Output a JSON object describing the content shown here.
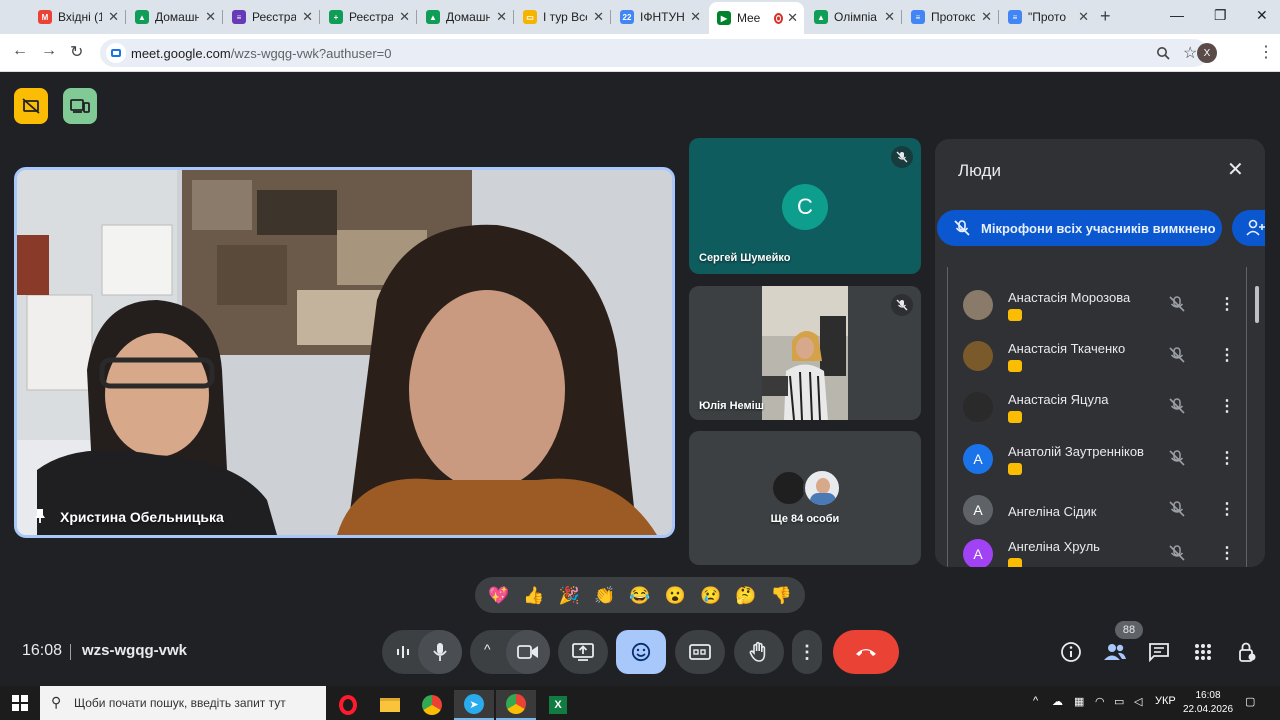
{
  "browser": {
    "tabs": [
      {
        "label": "Вхідні (1",
        "favicon": "gmail-icon",
        "color": "#ea4335",
        "glyph": "M"
      },
      {
        "label": "Домашн",
        "favicon": "drive-icon",
        "color": "#0f9d58",
        "glyph": "▲"
      },
      {
        "label": "Реєстра",
        "favicon": "forms-icon",
        "color": "#673ab7",
        "glyph": "≡"
      },
      {
        "label": "Реєстра",
        "favicon": "sheets-icon",
        "color": "#0f9d58",
        "glyph": "+"
      },
      {
        "label": "Домашн",
        "favicon": "drive-icon",
        "color": "#0f9d58",
        "glyph": "▲"
      },
      {
        "label": "І тур Всє",
        "favicon": "slides-icon",
        "color": "#f4b400",
        "glyph": "▭"
      },
      {
        "label": "ІФНТУНГ",
        "favicon": "calendar-icon",
        "color": "#4285f4",
        "glyph": "22"
      },
      {
        "label": "Mee",
        "favicon": "meet-icon",
        "color": "#00832d",
        "glyph": "▶",
        "active": true,
        "recording": true
      },
      {
        "label": "Олімпіа",
        "favicon": "drive-icon",
        "color": "#0f9d58",
        "glyph": "▲"
      },
      {
        "label": "Протоко",
        "favicon": "docs-icon",
        "color": "#4285f4",
        "glyph": "≡"
      },
      {
        "label": "\"Прото",
        "favicon": "docs-icon",
        "color": "#4285f4",
        "glyph": "≡"
      }
    ],
    "new_tab": "+",
    "url_host": "meet.google.com",
    "url_path": "/wzs-wgqg-vwk?authuser=0",
    "profile_initial": "X"
  },
  "meet": {
    "main_speaker": "Христина Обельницька",
    "tiles": [
      {
        "name": "Сергей Шумейко",
        "initial": "C",
        "avatar_color": "#0e9e8e"
      },
      {
        "name": "Юлія Неміш"
      },
      {
        "name": "Ще 84 особи"
      }
    ],
    "people_panel": {
      "title": "Люди",
      "mute_all_label": "Мікрофони всіх учасників вимкнено",
      "participants": [
        {
          "name": "Анастасія Морозова",
          "initial": "",
          "color": "#8a7a6a",
          "badge": true
        },
        {
          "name": "Анастасія Ткаченко",
          "initial": "",
          "color": "#7a5a2a",
          "badge": true
        },
        {
          "name": "Анастасія Яцула",
          "initial": "",
          "color": "#2a2a2a",
          "badge": true
        },
        {
          "name": "Анатолій Заутренніков",
          "initial": "A",
          "color": "#1a73e8",
          "badge": true
        },
        {
          "name": "Ангеліна Сідик",
          "initial": "A",
          "color": "#5f6368",
          "badge": false
        },
        {
          "name": "Ангеліна Хруль",
          "initial": "A",
          "color": "#a142f4",
          "badge": true
        }
      ]
    },
    "reactions": [
      "💖",
      "👍",
      "🎉",
      "👏",
      "😂",
      "😮",
      "😢",
      "🤔",
      "👎"
    ],
    "time": "16:08",
    "meeting_code": "wzs-wgqg-vwk",
    "participant_count": "88",
    "colors": {
      "end_call": "#ea4335",
      "emoji_active": "#a8c7fa",
      "accent": "#0b57d0"
    }
  },
  "taskbar": {
    "search_placeholder": "Щоби почати пошук, введіть запит тут",
    "language": "УКР",
    "clock_time": "16:08",
    "clock_date": "22.04.2026"
  }
}
